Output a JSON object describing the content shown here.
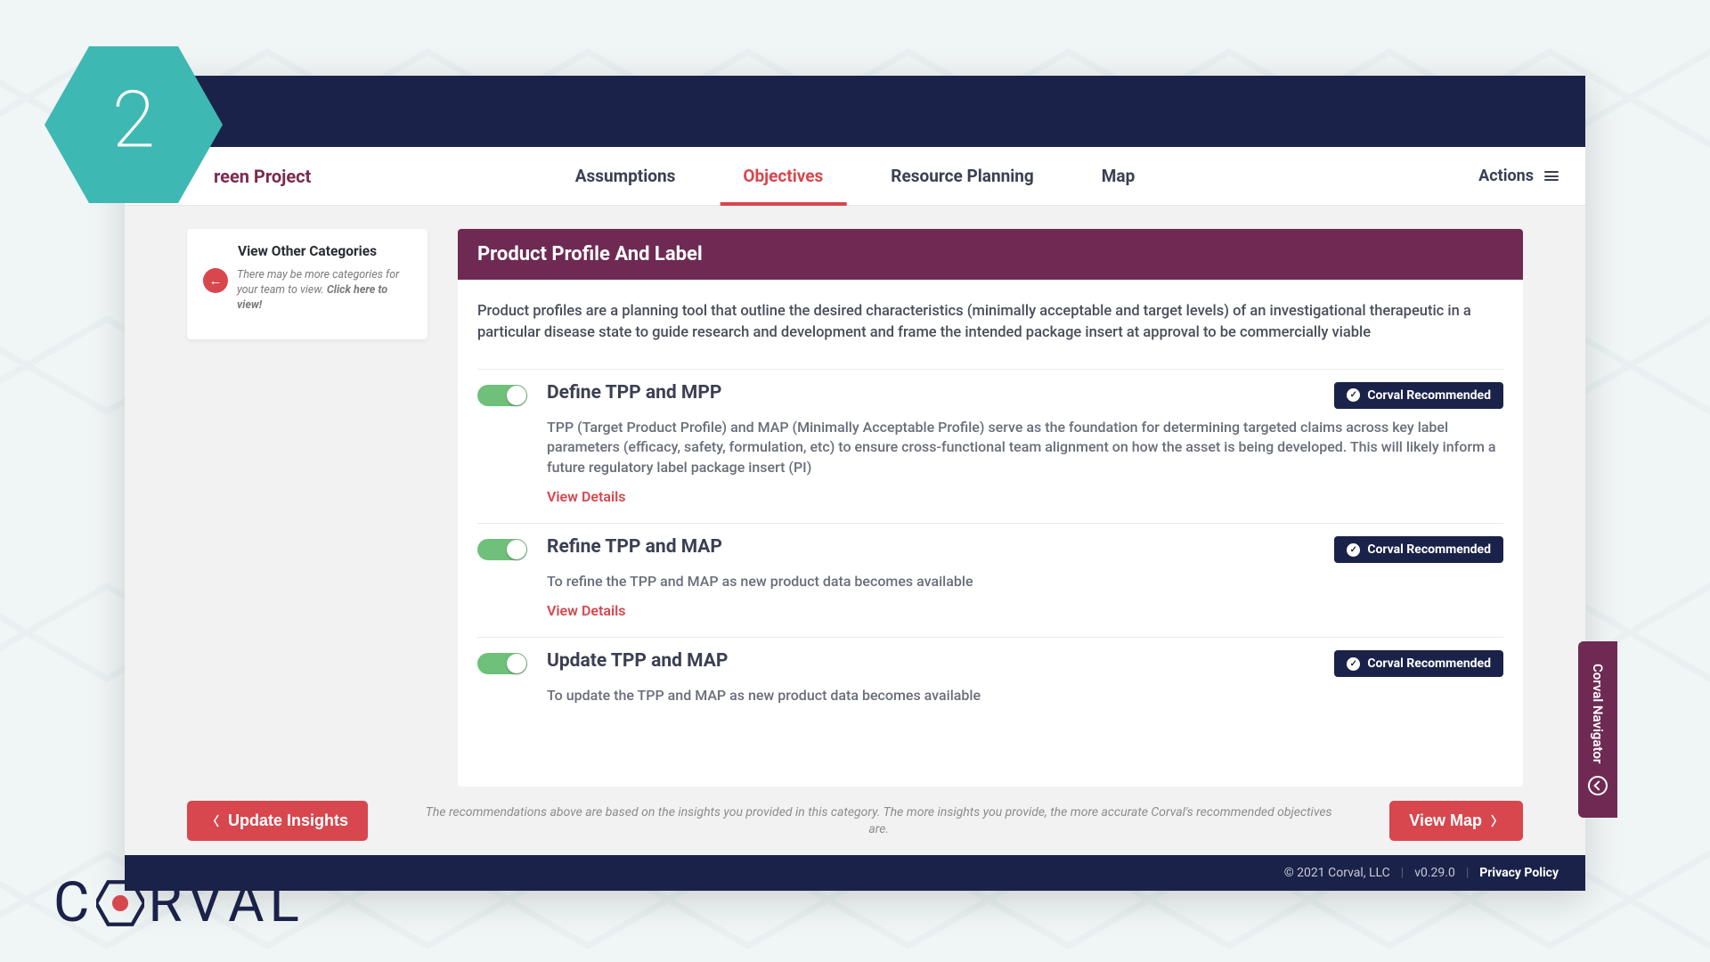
{
  "badge_number": "2",
  "project_name": "reen Project",
  "tabs": {
    "assumptions": "Assumptions",
    "objectives": "Objectives",
    "resource": "Resource Planning",
    "map": "Map"
  },
  "actions_label": "Actions",
  "sidebar": {
    "title": "View Other Categories",
    "text_prefix": "There may be more categories for your team to view. ",
    "text_bold": "Click here to view!"
  },
  "section": {
    "title": "Product Profile And Label",
    "description": "Product profiles are a planning tool that outline the desired characteristics (minimally acceptable and target levels) of an investigational therapeutic in a particular disease state to guide research and development and frame the intended package insert at approval to be commercially viable"
  },
  "badge_label": "Corval Recommended",
  "objectives": [
    {
      "title": "Define TPP and MPP",
      "desc": "TPP (Target Product Profile) and MAP (Minimally Acceptable Profile) serve as the foundation for determining targeted claims across key label parameters (efficacy, safety, formulation, etc) to ensure cross-functional team alignment on how the asset is being developed. This will likely inform a future regulatory label package insert (PI)",
      "details": "View Details"
    },
    {
      "title": "Refine TPP and MAP",
      "desc": "To refine the TPP and MAP as new product data becomes available",
      "details": "View Details"
    },
    {
      "title": "Update TPP and MAP",
      "desc": "To update the TPP and MAP as new product data becomes available",
      "details": null
    }
  ],
  "footer_actions": {
    "update": "Update Insights",
    "note": "The recommendations above are based on the insights you provided in this category. The more insights you provide, the more accurate Corval's recommended objectives are.",
    "view_map": "View Map"
  },
  "footer": {
    "copyright": "© 2021 Corval, LLC",
    "version": "v0.29.0",
    "privacy": "Privacy Policy"
  },
  "side_tab": "Corval Navigator",
  "brand_letters": {
    "c": "C",
    "r": "R",
    "v": "V",
    "a": "A",
    "l": "L"
  }
}
